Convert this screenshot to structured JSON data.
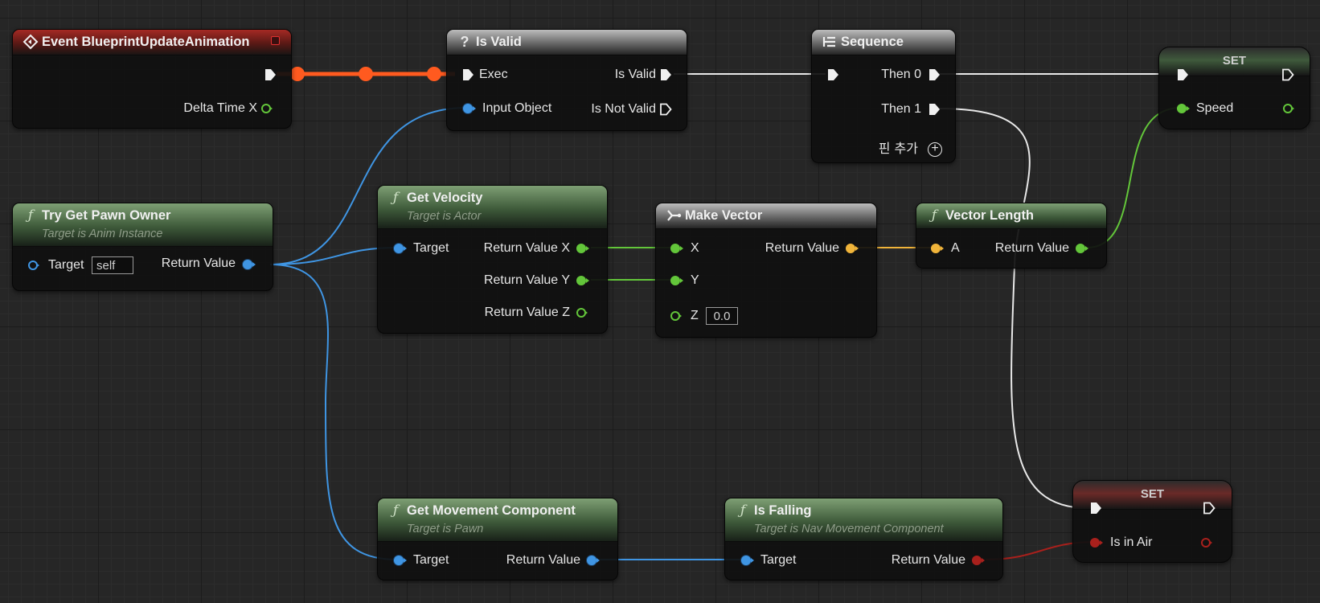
{
  "colors": {
    "exec_wire": "#e8e8e8",
    "exec_wire_active": "#ff5a1f",
    "object_wire": "#3f95e3",
    "float_wire": "#63c63a",
    "vector_wire": "#f0b43a",
    "bool_wire": "#a8201c"
  },
  "nodes": {
    "event_update": {
      "title": "Event BlueprintUpdateAnimation",
      "icon": "event-diamond-icon",
      "delta_time": "Delta Time X"
    },
    "is_valid": {
      "title": "Is Valid",
      "icon": "question-icon",
      "exec": "Exec",
      "is_valid": "Is Valid",
      "input_object": "Input Object",
      "is_not_valid": "Is Not Valid"
    },
    "sequence": {
      "title": "Sequence",
      "icon": "sequence-icon",
      "then0": "Then 0",
      "then1": "Then 1",
      "add_pin": "핀 추가"
    },
    "set_speed": {
      "title": "SET",
      "speed": "Speed"
    },
    "try_get_pawn_owner": {
      "title": "Try Get Pawn Owner",
      "subtitle": "Target is Anim Instance",
      "target": "Target",
      "target_value": "self",
      "return_value": "Return Value"
    },
    "get_velocity": {
      "title": "Get Velocity",
      "subtitle": "Target is Actor",
      "target": "Target",
      "rx": "Return Value X",
      "ry": "Return Value Y",
      "rz": "Return Value Z"
    },
    "make_vector": {
      "title": "Make Vector",
      "icon": "make-struct-icon",
      "x": "X",
      "y": "Y",
      "z": "Z",
      "z_value": "0.0",
      "return_value": "Return Value"
    },
    "vector_length": {
      "title": "Vector Length",
      "a": "A",
      "return_value": "Return Value"
    },
    "get_movement_component": {
      "title": "Get Movement Component",
      "subtitle": "Target is Pawn",
      "target": "Target",
      "return_value": "Return Value"
    },
    "is_falling": {
      "title": "Is Falling",
      "subtitle": "Target is Nav Movement Component",
      "target": "Target",
      "return_value": "Return Value"
    },
    "set_in_air": {
      "title": "SET",
      "is_in_air": "Is in Air"
    }
  }
}
